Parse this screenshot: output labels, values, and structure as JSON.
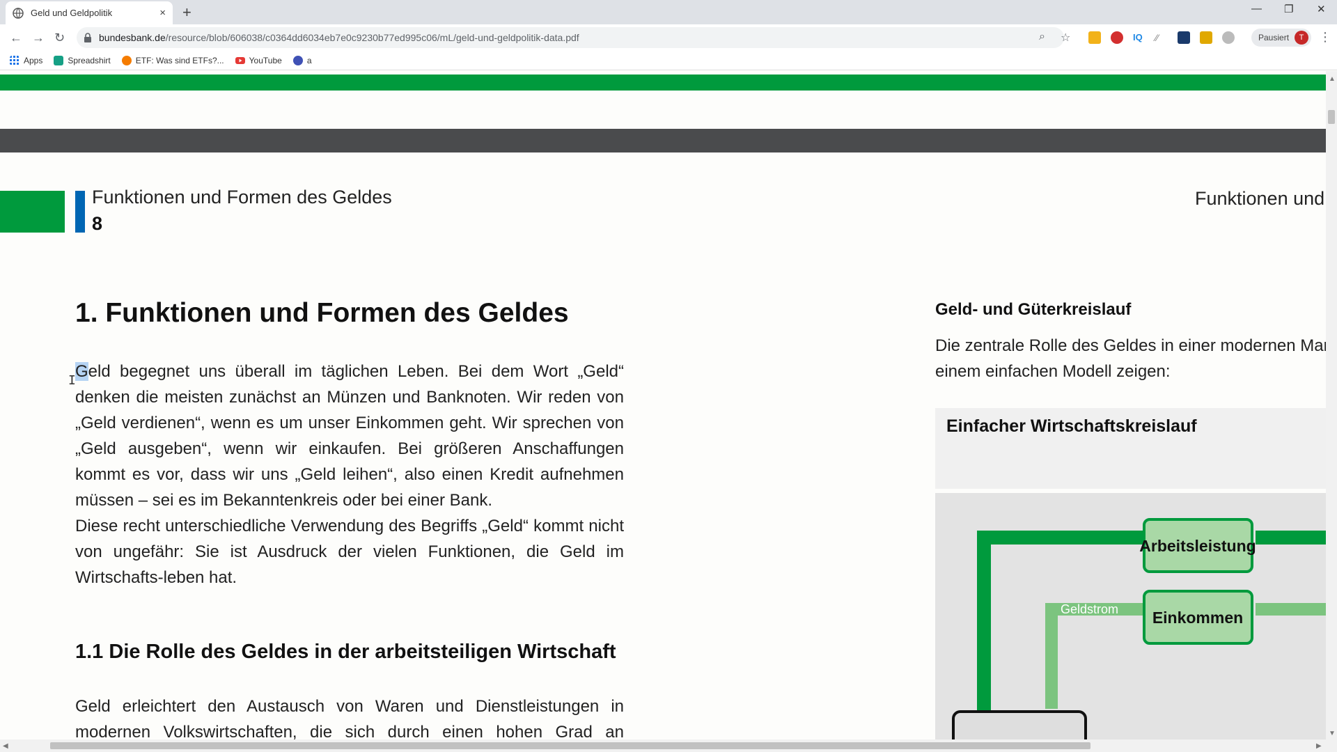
{
  "browser": {
    "tab_title": "Geld und Geldpolitik",
    "new_tab": "+",
    "close": "×",
    "url_host": "bundesbank.de",
    "url_path": "/resource/blob/606038/c0364dd6034eb7e0c9230b77ed995c06/mL/geld-und-geldpolitik-data.pdf",
    "profile_label": "Pausiert",
    "profile_initial": "T",
    "bookmarks": [
      "Apps",
      "Spreadshirt",
      "ETF: Was sind ETFs?...",
      "YouTube",
      "a"
    ]
  },
  "pdf": {
    "header_title": "Funktionen und Formen des Geldes",
    "page_number": "8",
    "header_right": "Funktionen und",
    "heading1": "1. Funktionen und Formen des Geldes",
    "para1_first_letter": "G",
    "para1_rest": "eld begegnet uns überall im täglichen Leben. Bei dem Wort „Geld“ denken die meisten zunächst an Münzen und Banknoten. Wir reden von „Geld verdienen“, wenn es um unser Einkommen geht. Wir sprechen von „Geld ausgeben“, wenn wir einkaufen. Bei größeren Anschaffungen kommt es vor, dass wir uns „Geld leihen“, also einen Kredit aufnehmen müssen – sei es im Bekanntenkreis oder bei einer Bank.",
    "para2": "Diese recht unterschiedliche Verwendung des Begriffs „Geld“ kommt nicht von ungefähr: Sie ist Ausdruck der vielen Funktionen, die Geld im Wirtschafts-leben hat.",
    "heading2": "1.1 Die Rolle des Geldes in der arbeitsteiligen Wirtschaft",
    "para3": "Geld erleichtert den Austausch von Waren und Dienstleistungen in modernen Volkswirtschaften, die sich durch einen hohen Grad an Arbeitsteilung und",
    "right_heading": "Geld- und Güterkreislauf",
    "right_line1": "Die zentrale Rolle des Geldes in einer modernen Markt",
    "right_line2": "einem einfachen Modell zeigen:",
    "panel_title": "Einfacher Wirtschaftskreislauf",
    "diagram": {
      "box1": "Arbeitsleistung",
      "box2": "Einkommen",
      "flow_label": "Geldstrom"
    }
  },
  "colors": {
    "brand_green": "#009a3d",
    "light_green": "#7cc47f",
    "box_fill": "#a9d8a6",
    "brand_blue": "#0066b3",
    "dark_band": "#4a4b4d"
  }
}
